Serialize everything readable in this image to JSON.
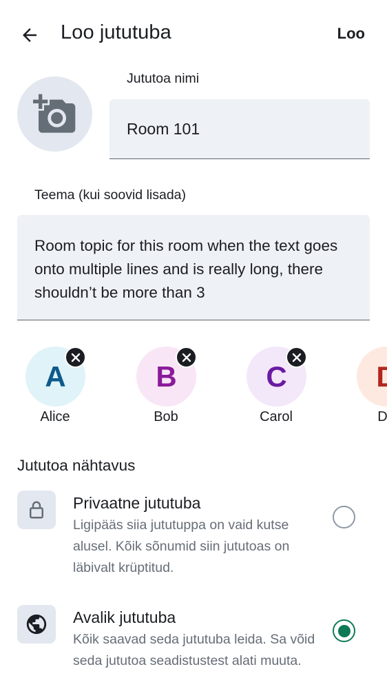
{
  "header": {
    "title": "Loo jututuba",
    "action_label": "Loo",
    "back_icon": "arrow-left-icon"
  },
  "avatar_picker": {
    "icon": "add-photo-icon"
  },
  "room_name": {
    "label": "Jututoa nimi",
    "value": "Room 101"
  },
  "topic": {
    "label": "Teema (kui soovid lisada)",
    "value": "Room topic for this room when the text goes onto multiple lines and is really long, there shouldn’t be more than 3"
  },
  "members": [
    {
      "initial": "A",
      "name": "Alice",
      "bg": "#dff3f8",
      "fg": "#0e5a8c",
      "removable": true
    },
    {
      "initial": "B",
      "name": "Bob",
      "bg": "#f8e6f6",
      "fg": "#8a1a9b",
      "removable": true
    },
    {
      "initial": "C",
      "name": "Carol",
      "bg": "#f3e7fa",
      "fg": "#6a1ba2",
      "removable": true
    },
    {
      "initial": "D",
      "name": "Da",
      "bg": "#fde9df",
      "fg": "#b3261e",
      "removable": false
    }
  ],
  "visibility": {
    "title": "Jututoa nähtavus",
    "options": [
      {
        "title": "Privaatne jututuba",
        "description": "Ligipääs siia jututuppa on vaid kutse alusel. Kõik sõnumid siin jututoas on läbivalt krüptitud.",
        "icon": "lock-icon",
        "selected": false
      },
      {
        "title": "Avalik jututuba",
        "description": "Kõik saavad seda jututuba leida. Sa võid seda jututoa seadistustest alati muuta.",
        "icon": "globe-icon",
        "selected": true
      }
    ]
  },
  "colors": {
    "accent": "#0e7a55",
    "field_bg": "#eef1f6",
    "icon_bg": "#e3e7ef",
    "secondary_text": "#656d77"
  }
}
